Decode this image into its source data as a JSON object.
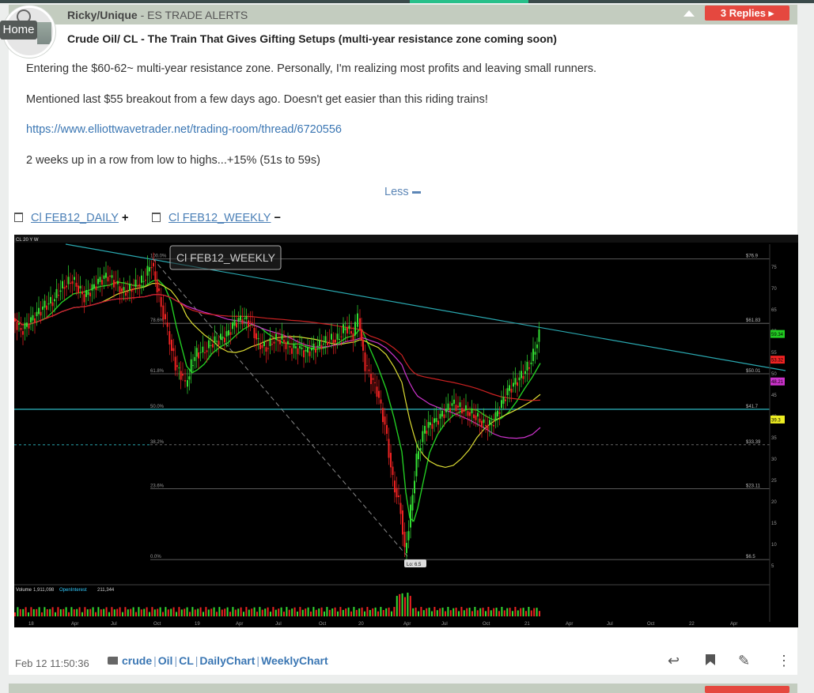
{
  "post": {
    "author": "Ricky/Unique",
    "room": " - ES TRADE ALERTS",
    "title": "Crude Oil/ CL - The Train That Gives Gifting Setups (multi-year resistance zone coming soon)",
    "replies_label": "3 Replies",
    "home_label": "Home",
    "paragraphs": {
      "p1": "Entering the $60-62~ multi-year resistance zone. Personally, I'm realizing most profits and leaving small runners.",
      "p2": "Mentioned last $55 breakout from a few days ago. Doesn't get easier than this riding trains!",
      "link": "https://www.elliottwavetrader.net/trading-room/thread/6720556",
      "p3": "2 weeks up in a row from low to highs...+15% (51s to 59s)"
    },
    "less_label": "Less",
    "attachments": [
      {
        "label": "Cl FEB12_DAILY",
        "toggle": "+"
      },
      {
        "label": "Cl FEB12_WEEKLY",
        "toggle": "−"
      }
    ],
    "timestamp": "Feb 12 11:50:36",
    "tags": [
      "crude",
      "Oil",
      "CL",
      "DailyChart",
      "WeeklyChart"
    ]
  },
  "chart_data": {
    "type": "candlestick",
    "title": "Cl FEB12_WEEKLY",
    "symbol_header": "CL 20 Y W",
    "fib_levels": [
      {
        "pct": "100.0%",
        "price": "$76.9",
        "value": 76.9
      },
      {
        "pct": "78.6%",
        "price": "$61.83",
        "value": 61.83
      },
      {
        "pct": "61.8%",
        "price": "$50.01",
        "value": 50.01
      },
      {
        "pct": "50.0%",
        "price": "$41.7",
        "value": 41.7
      },
      {
        "pct": "38.2%",
        "price": "$33.39",
        "value": 33.39
      },
      {
        "pct": "23.6%",
        "price": "$23.11",
        "value": 23.11
      },
      {
        "pct": "0.0%",
        "price": "$6.5",
        "value": 6.5
      }
    ],
    "low_label": "Lo: 6.5",
    "y_ticks": [
      "75",
      "70",
      "65",
      "60",
      "55",
      "50",
      "45",
      "40",
      "35",
      "30",
      "25",
      "20",
      "15",
      "10",
      "5"
    ],
    "x_ticks": [
      "18",
      "Apr",
      "Jul",
      "Oct",
      "19",
      "Apr",
      "Jul",
      "Oct",
      "20",
      "Apr",
      "Jul",
      "Oct",
      "21",
      "Apr",
      "Jul",
      "Oct",
      "22",
      "Apr"
    ],
    "badges": [
      {
        "text": "59.34",
        "color": "#22cc22",
        "value": 59.34
      },
      {
        "text": "53.32",
        "color": "#ee2222",
        "value": 53.32
      },
      {
        "text": "48.21",
        "color": "#cc33cc",
        "value": 48.21
      },
      {
        "text": "39.3",
        "color": "#eeee22",
        "value": 39.3
      }
    ],
    "volume_label": "Volume",
    "volume_value": "1,911,098",
    "oi_label": "OpenInterest",
    "oi_value": "211,344",
    "y_range": [
      3,
      80
    ]
  }
}
